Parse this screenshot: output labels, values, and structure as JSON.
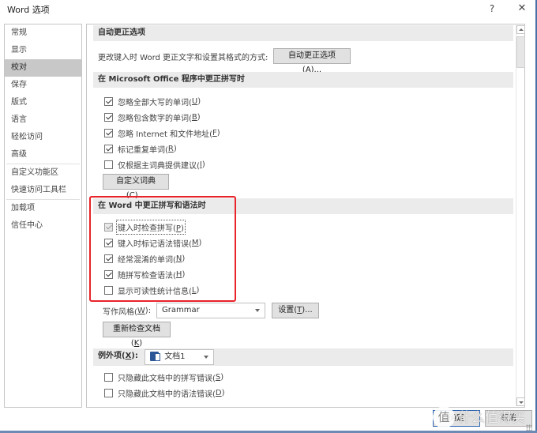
{
  "window": {
    "title": "Word 选项",
    "help_label": "?",
    "close_label": "✕"
  },
  "sidebar": {
    "items": [
      {
        "label": "常规"
      },
      {
        "label": "显示"
      },
      {
        "label": "校对",
        "active": true
      },
      {
        "label": "保存"
      },
      {
        "label": "版式"
      },
      {
        "label": "语言"
      },
      {
        "label": "轻松访问"
      },
      {
        "label": "高级"
      },
      {
        "label": "自定义功能区"
      },
      {
        "label": "快速访问工具栏"
      },
      {
        "label": "加载项"
      },
      {
        "label": "信任中心"
      }
    ]
  },
  "autocorrect": {
    "header": "自动更正选项",
    "description": "更改键入时 Word 更正文字和设置其格式的方式:",
    "button_label": "自动更正选项(",
    "button_key": "A",
    "button_suffix": ")..."
  },
  "office_spelling": {
    "header": "在 Microsoft Office 程序中更正拼写时",
    "options": [
      {
        "label": "忽略全部大写的单词(",
        "key": "U",
        "checked": true
      },
      {
        "label": "忽略包含数字的单词(",
        "key": "B",
        "checked": true
      },
      {
        "label": "忽略 Internet 和文件地址(",
        "key": "F",
        "checked": true
      },
      {
        "label": "标记重复单词(",
        "key": "R",
        "checked": true
      },
      {
        "label": "仅根据主词典提供建议(",
        "key": "I",
        "checked": false
      }
    ],
    "custom_dict_label": "自定义词典(",
    "custom_dict_key": "C",
    "custom_dict_suffix": ")..."
  },
  "word_spelling": {
    "header": "在 Word 中更正拼写和语法时",
    "options": [
      {
        "label": "键入时检查拼写(",
        "key": "P",
        "checked": true,
        "disabled": true
      },
      {
        "label": "键入时标记语法错误(",
        "key": "M",
        "checked": true
      },
      {
        "label": "经常混淆的单词(",
        "key": "N",
        "checked": true
      },
      {
        "label": "随拼写检查语法(",
        "key": "H",
        "checked": true
      },
      {
        "label": "显示可读性统计信息(",
        "key": "L",
        "checked": false
      }
    ],
    "writing_style_label": "写作风格(",
    "writing_style_key": "W",
    "writing_style_suffix": "):",
    "writing_style_value": "Grammar",
    "settings_label": "设置(",
    "settings_key": "T",
    "settings_suffix": ")...",
    "recheck_label": "重新检查文档(",
    "recheck_key": "K",
    "recheck_suffix": ")"
  },
  "exceptions": {
    "label": "例外项(",
    "key": "X",
    "suffix": "):",
    "document_value": "文档1",
    "options": [
      {
        "label": "只隐藏此文档中的拼写错误(",
        "key": "S",
        "checked": false
      },
      {
        "label": "只隐藏此文档中的语法错误(",
        "key": "D",
        "checked": false
      }
    ]
  },
  "footer": {
    "ok_label": "确定",
    "cancel_label": "取消"
  },
  "watermark": {
    "circle_char": "值",
    "text": "什么值得买"
  },
  "colors": {
    "highlight_box": "#e8232a",
    "active_sidebar": "#c8c8c8",
    "section_header_bg": "#ebebeb",
    "window_border": "#4a6fa5"
  }
}
